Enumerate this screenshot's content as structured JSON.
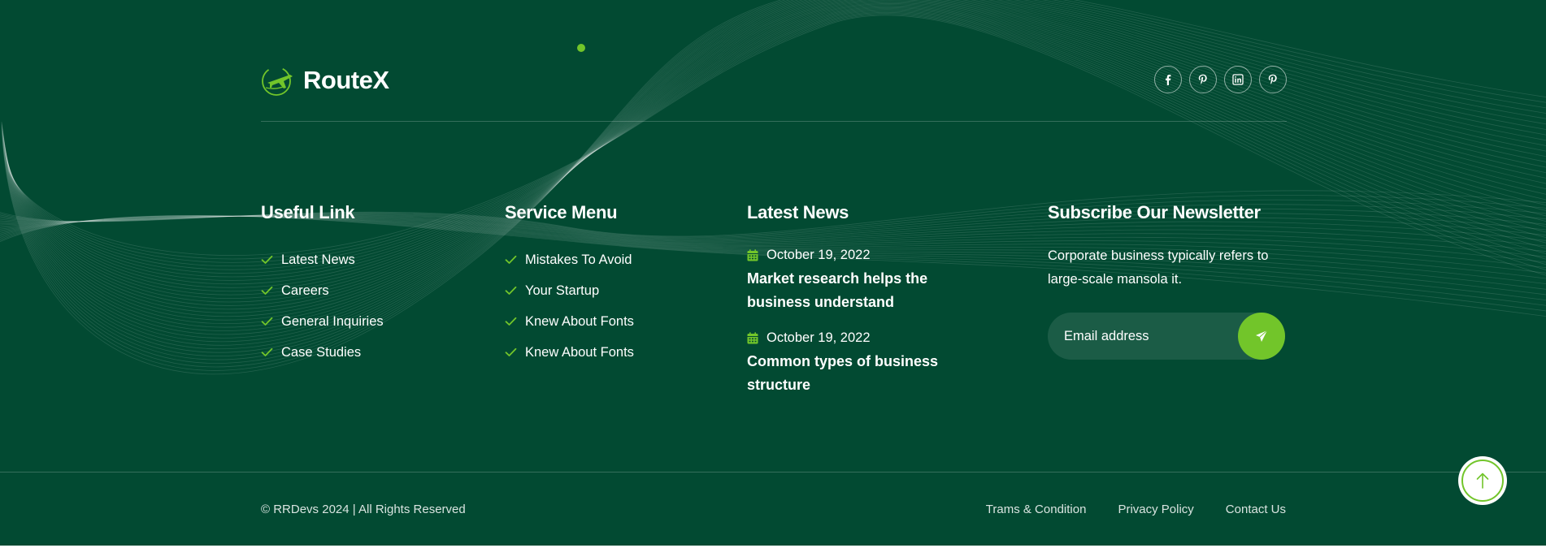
{
  "brand": {
    "name": "RouteX",
    "logo_icon": "airplane-logo-icon"
  },
  "colors": {
    "background": "#024a32",
    "accent": "#72c52a",
    "text": "#ffffff"
  },
  "socials": [
    {
      "icon": "facebook-icon"
    },
    {
      "icon": "pinterest-icon"
    },
    {
      "icon": "linkedin-icon"
    },
    {
      "icon": "pinterest-icon"
    }
  ],
  "useful_link": {
    "title": "Useful Link",
    "items": [
      "Latest News",
      "Careers",
      "General Inquiries",
      "Case Studies"
    ]
  },
  "service_menu": {
    "title": "Service Menu",
    "items": [
      "Mistakes To Avoid",
      "Your Startup",
      "Knew About Fonts",
      "Knew About Fonts"
    ]
  },
  "latest_news": {
    "title": "Latest News",
    "items": [
      {
        "date": "October 19, 2022",
        "title": "Market research helps the business understand"
      },
      {
        "date": "October 19, 2022",
        "title": "Common types of business structure"
      }
    ]
  },
  "newsletter": {
    "title": "Subscribe Our Newsletter",
    "text": "Corporate business typically refers to large-scale mansola it.",
    "placeholder": "Email address",
    "value": ""
  },
  "bottom": {
    "copyright": "© RRDevs 2024 | All Rights Reserved",
    "links": [
      "Trams & Condition",
      "Privacy Policy",
      "Contact Us"
    ]
  }
}
